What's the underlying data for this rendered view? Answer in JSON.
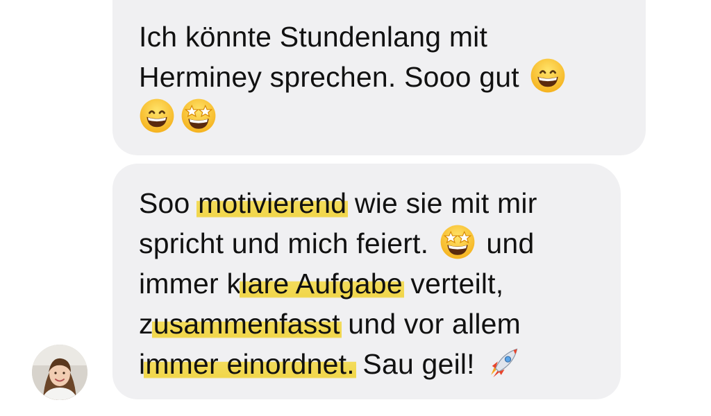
{
  "conversation": {
    "messages": [
      {
        "lines": [
          {
            "parts": [
              "Ich könnte Stundenlang mit"
            ]
          },
          {
            "parts": [
              "Herminey sprechen. Sooo gut "
            ]
          },
          {
            "parts": [
              ""
            ]
          }
        ],
        "emojis": [
          "grinning-face-with-smiling-eyes",
          "grinning-face-with-smiling-eyes",
          "star-struck"
        ]
      },
      {
        "lines": [
          {
            "parts": [
              "Soo ",
              "motivierend",
              " wie sie mit mir"
            ]
          },
          {
            "parts": [
              "spricht und mich feiert. ",
              " und"
            ]
          },
          {
            "parts": [
              "immer k",
              "lare Aufgabe",
              " verteilt,"
            ]
          },
          {
            "parts": [
              "z",
              "usammenfasst",
              " und vor allem"
            ]
          },
          {
            "parts": [
              "i",
              "mmer einordnet.",
              " Sau geil! "
            ]
          }
        ],
        "emojis": [
          "star-struck",
          "rocket"
        ],
        "highlight_color": "#f1d64a"
      }
    ],
    "sender": {
      "avatar": "profile-photo-woman-brown-hair"
    },
    "colors": {
      "bubble_background": "#f0f0f2",
      "text": "#111111",
      "highlight": "#f1d64a"
    }
  }
}
